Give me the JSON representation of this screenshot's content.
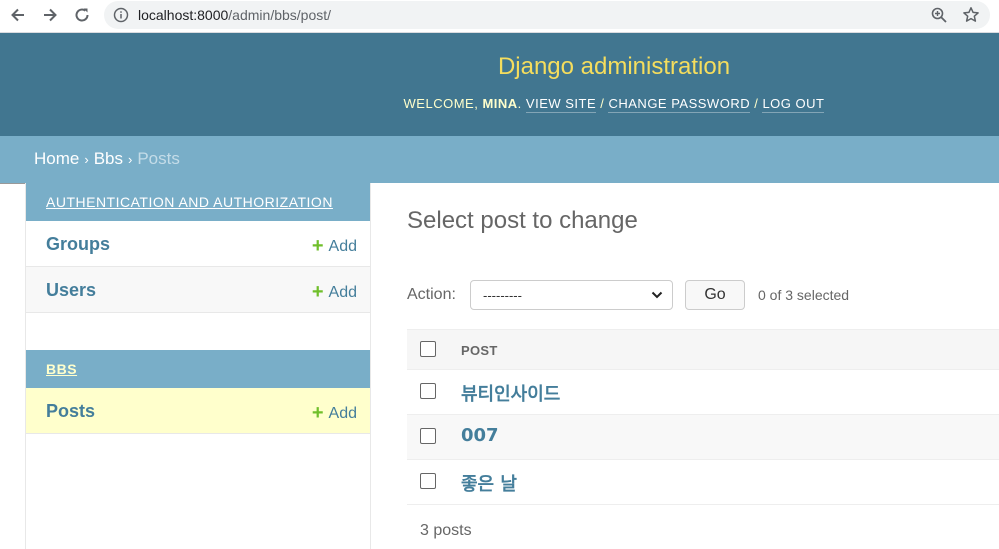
{
  "browser": {
    "url_host": "localhost:8000",
    "url_path": "/admin/bbs/post/"
  },
  "header": {
    "branding": "Django administration",
    "welcome": "Welcome,",
    "username": "mina",
    "view_site": "View site",
    "change_password": "Change password",
    "log_out": "Log out"
  },
  "breadcrumbs": {
    "home": "Home",
    "app": "Bbs",
    "current": "Posts",
    "separator": "›"
  },
  "sidebar": {
    "modules": [
      {
        "caption": "Authentication and Authorization",
        "models": [
          {
            "name": "Groups",
            "add": "Add"
          },
          {
            "name": "Users",
            "add": "Add"
          }
        ]
      },
      {
        "caption": "Bbs",
        "models": [
          {
            "name": "Posts",
            "add": "Add"
          }
        ]
      }
    ]
  },
  "content": {
    "title": "Select post to change",
    "action_label": "Action:",
    "action_selected_option": "---------",
    "go_button": "Go",
    "selected_count": "0 of 3 selected",
    "column_header": "Post",
    "rows": [
      "뷰티인사이드",
      "007",
      "좋은 날"
    ],
    "paginator": "3 posts"
  },
  "colors": {
    "header_bg": "#417690",
    "branding": "#f5dd5d",
    "breadcrumbs_bg": "#79aec8",
    "link": "#447e9b",
    "add_plus": "#70bf2b",
    "selected_row": "#ffffcc"
  }
}
